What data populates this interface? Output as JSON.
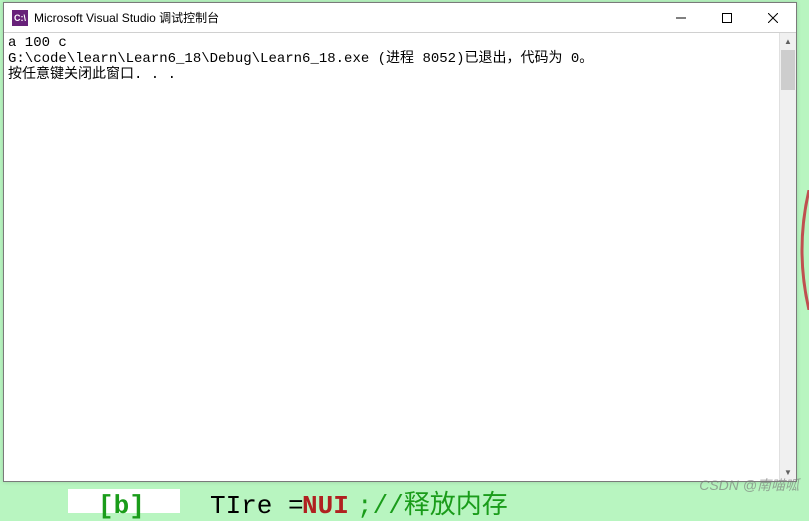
{
  "window": {
    "title": "Microsoft Visual Studio 调试控制台",
    "icon_label": "VS"
  },
  "console": {
    "line1": "a 100 c",
    "line2": "G:\\code\\learn\\Learn6_18\\Debug\\Learn6_18.exe (进程 8052)已退出，代码为 0。",
    "line3": "按任意键关闭此窗口. . ."
  },
  "watermark": "CSDN @南喵呱",
  "background": {
    "frag1": "[b]",
    "frag2": "TIre =",
    "frag3": "NUI",
    "frag4": ";//释放内存"
  }
}
